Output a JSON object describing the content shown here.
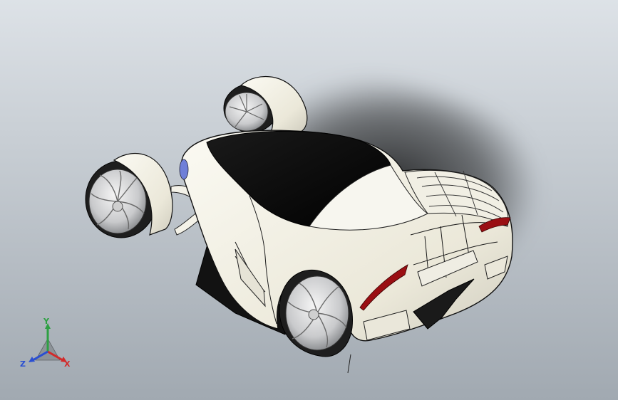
{
  "viewport": {
    "background_top": "#dde2e7",
    "background_bottom": "#a1a9b1"
  },
  "model": {
    "body_color": "#f2f0e4",
    "canopy_color": "#0b0b0b",
    "taillight_color": "#9a0f13",
    "headlight_color": "#6f7fd8",
    "tire_color": "#1e1e1e",
    "rim_color": "#d5d6d8"
  },
  "triad": {
    "y_label": "Y",
    "x_label": "X",
    "z_label": "Z",
    "y_color": "#2ea043",
    "x_color": "#d22a2a",
    "z_color": "#2a4fd2"
  }
}
